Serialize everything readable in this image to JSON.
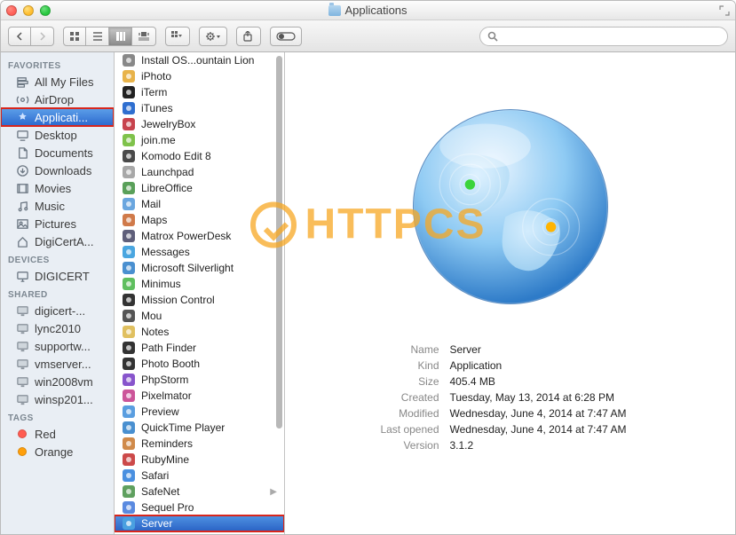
{
  "window": {
    "title": "Applications"
  },
  "search": {
    "placeholder": ""
  },
  "sidebar": {
    "sections": [
      {
        "header": "FAVORITES",
        "items": [
          {
            "label": "All My Files",
            "icon": "all-my-files"
          },
          {
            "label": "AirDrop",
            "icon": "airdrop"
          },
          {
            "label": "Applicati...",
            "icon": "applications",
            "selected": true,
            "highlighted": true
          },
          {
            "label": "Desktop",
            "icon": "desktop"
          },
          {
            "label": "Documents",
            "icon": "documents"
          },
          {
            "label": "Downloads",
            "icon": "downloads"
          },
          {
            "label": "Movies",
            "icon": "movies"
          },
          {
            "label": "Music",
            "icon": "music"
          },
          {
            "label": "Pictures",
            "icon": "pictures"
          },
          {
            "label": "DigiCertA...",
            "icon": "home"
          }
        ]
      },
      {
        "header": "DEVICES",
        "items": [
          {
            "label": "DIGICERT",
            "icon": "imac"
          }
        ]
      },
      {
        "header": "SHARED",
        "items": [
          {
            "label": "digicert-...",
            "icon": "network-drive"
          },
          {
            "label": "lync2010",
            "icon": "network-drive"
          },
          {
            "label": "supportw...",
            "icon": "network-drive"
          },
          {
            "label": "vmserver...",
            "icon": "network-drive"
          },
          {
            "label": "win2008vm",
            "icon": "network-drive"
          },
          {
            "label": "winsp201...",
            "icon": "network-drive"
          }
        ]
      },
      {
        "header": "TAGS",
        "items": [
          {
            "label": "Red",
            "tag": "#ff5b50"
          },
          {
            "label": "Orange",
            "tag": "#ff9f0a"
          }
        ]
      }
    ]
  },
  "filelist": {
    "items": [
      {
        "label": "Install OS...ountain Lion"
      },
      {
        "label": "iPhoto"
      },
      {
        "label": "iTerm"
      },
      {
        "label": "iTunes"
      },
      {
        "label": "JewelryBox"
      },
      {
        "label": "join.me"
      },
      {
        "label": "Komodo Edit 8"
      },
      {
        "label": "Launchpad"
      },
      {
        "label": "LibreOffice"
      },
      {
        "label": "Mail"
      },
      {
        "label": "Maps"
      },
      {
        "label": "Matrox PowerDesk"
      },
      {
        "label": "Messages"
      },
      {
        "label": "Microsoft Silverlight"
      },
      {
        "label": "Minimus"
      },
      {
        "label": "Mission Control"
      },
      {
        "label": "Mou"
      },
      {
        "label": "Notes"
      },
      {
        "label": "Path Finder"
      },
      {
        "label": "Photo Booth"
      },
      {
        "label": "PhpStorm"
      },
      {
        "label": "Pixelmator"
      },
      {
        "label": "Preview"
      },
      {
        "label": "QuickTime Player"
      },
      {
        "label": "Reminders"
      },
      {
        "label": "RubyMine"
      },
      {
        "label": "Safari"
      },
      {
        "label": "SafeNet",
        "hasSubmenu": true
      },
      {
        "label": "Sequel Pro"
      },
      {
        "label": "Server",
        "selected": true,
        "highlighted": true
      }
    ]
  },
  "preview": {
    "labels": {
      "name": "Name",
      "kind": "Kind",
      "size": "Size",
      "created": "Created",
      "modified": "Modified",
      "lastopened": "Last opened",
      "version": "Version"
    },
    "values": {
      "name": "Server",
      "kind": "Application",
      "size": "405.4 MB",
      "created": "Tuesday, May 13, 2014 at 6:28 PM",
      "modified": "Wednesday, June 4, 2014 at 7:47 AM",
      "lastopened": "Wednesday, June 4, 2014 at 7:47 AM",
      "version": "3.1.2"
    }
  },
  "watermark": {
    "text": "HTTPCS"
  }
}
